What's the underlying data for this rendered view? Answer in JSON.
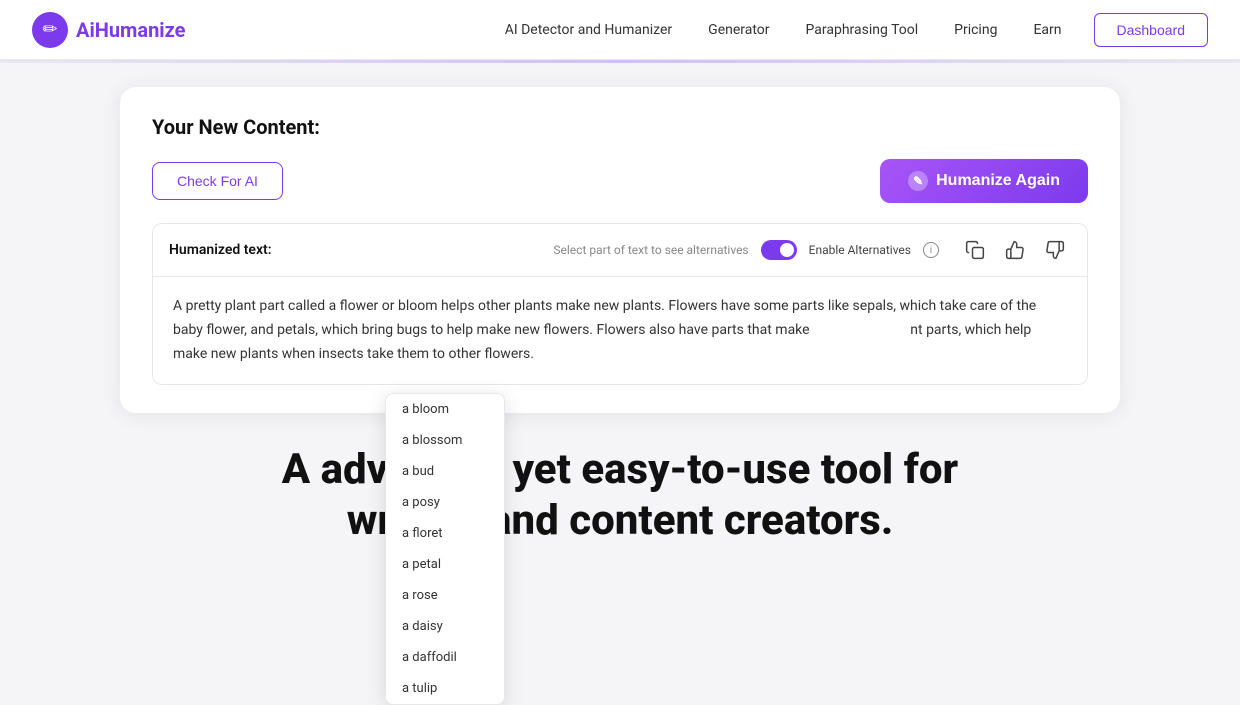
{
  "navbar": {
    "logo_text_ai": "Ai",
    "logo_text_humanize": "Humanize",
    "logo_icon": "✏",
    "nav_links": [
      {
        "id": "ai-detector",
        "label": "AI Detector and Humanizer"
      },
      {
        "id": "generator",
        "label": "Generator"
      },
      {
        "id": "paraphrasing",
        "label": "Paraphrasing Tool"
      },
      {
        "id": "pricing",
        "label": "Pricing"
      },
      {
        "id": "earn",
        "label": "Earn"
      }
    ],
    "dashboard_label": "Dashboard"
  },
  "card": {
    "title": "Your New Content:",
    "check_ai_label": "Check For AI",
    "humanize_again_label": "Humanize Again",
    "humanize_icon": "✎",
    "text_label": "Humanized text:",
    "alternatives_hint": "Select part of text to see alternatives",
    "enable_alternatives_label": "Enable Alternatives",
    "content": "A pretty plant part called a flower or bloom helps other plants make new plants. Flowers have some parts like sepals, which take care of the baby flower, and petals, which bring bugs to help make new flowers. Flowers also have parts that make",
    "content_suffix": "nt parts, which help make new plants when insects take them to other flowers."
  },
  "dropdown": {
    "items": [
      "a bloom",
      "a blossom",
      "a bud",
      "a posy",
      "a floret",
      "a petal",
      "a rose",
      "a daisy",
      "a daffodil",
      "a tulip"
    ]
  },
  "bottom": {
    "line1_prefix": "A adva",
    "line1_suffix": "d yet easy-to-use tool for",
    "line2_prefix": "wr",
    "line2_suffix": "and content creators."
  },
  "icons": {
    "copy": "⧉",
    "thumbup": "👍",
    "thumbdown": "👎",
    "info": "i",
    "pencil": "✎"
  }
}
